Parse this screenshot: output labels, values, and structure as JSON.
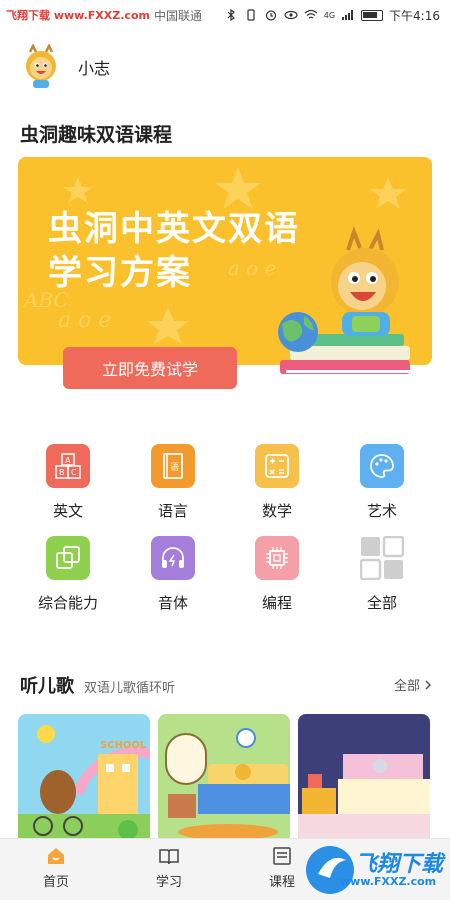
{
  "status_bar": {
    "watermark": "飞翔下载 www.FXXZ.com",
    "app_label": "中国联通",
    "network": "4G",
    "time": "下午4:16"
  },
  "profile": {
    "username": "小志"
  },
  "courses": {
    "heading": "虫洞趣味双语课程",
    "banner": {
      "title_line1": "虫洞中英文双语",
      "title_line2": "学习方案",
      "button_label": "立即免费试学",
      "color": "#fbc12d"
    }
  },
  "categories": [
    {
      "label": "英文",
      "icon": "abc-blocks-icon",
      "color": "#ef6a5b"
    },
    {
      "label": "语言",
      "icon": "book-language-icon",
      "color": "#f39a2c"
    },
    {
      "label": "数学",
      "icon": "calculator-icon",
      "color": "#f7c04b"
    },
    {
      "label": "艺术",
      "icon": "palette-icon",
      "color": "#5fb0f0"
    },
    {
      "label": "综合能力",
      "icon": "layers-icon",
      "color": "#8fd14f"
    },
    {
      "label": "音体",
      "icon": "headphones-icon",
      "color": "#a57ddb"
    },
    {
      "label": "编程",
      "icon": "chip-icon",
      "color": "#f5a0a8"
    },
    {
      "label": "全部",
      "icon": "grid-icon",
      "color": "#c8c8c8"
    }
  ],
  "songs": {
    "title": "听儿歌",
    "subtitle": "双语儿歌循环听",
    "all_label": "全部"
  },
  "bottom_nav": [
    {
      "label": "首页",
      "icon": "home-icon"
    },
    {
      "label": "学习",
      "icon": "open-book-icon"
    },
    {
      "label": "课程",
      "icon": "course-list-icon"
    }
  ],
  "watermark_bottom": {
    "line1": "飞翔下载",
    "line2": "www.FXXZ.com"
  }
}
